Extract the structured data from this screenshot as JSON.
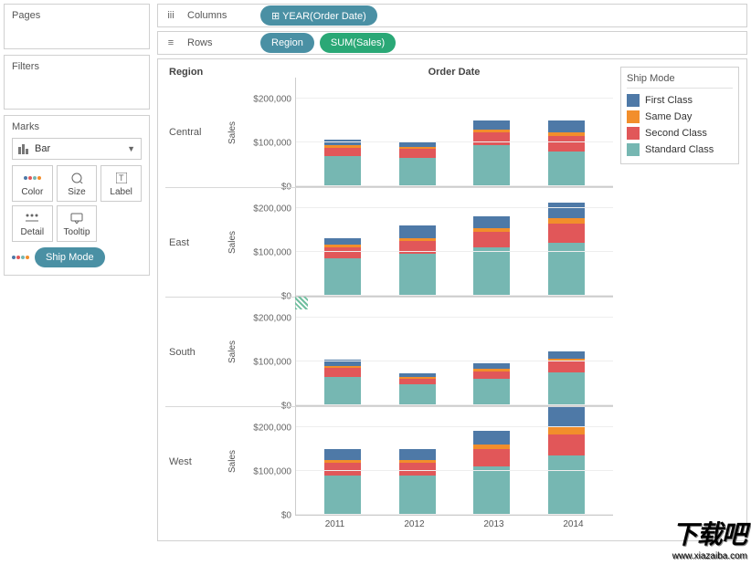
{
  "left": {
    "pages_title": "Pages",
    "filters_title": "Filters",
    "marks_title": "Marks",
    "mark_type": "Bar",
    "buttons": {
      "color": "Color",
      "size": "Size",
      "label": "Label",
      "detail": "Detail",
      "tooltip": "Tooltip"
    },
    "color_pill": "Ship Mode"
  },
  "shelves": {
    "columns_label": "Columns",
    "rows_label": "Rows",
    "year_pill": "⊞ YEAR(Order Date)",
    "region_pill": "Region",
    "sum_pill": "SUM(Sales)"
  },
  "chart": {
    "region_header": "Region",
    "orderdate_header": "Order Date",
    "y_label": "Sales",
    "y_ticks": [
      "$0",
      "$100,000",
      "$200,000"
    ],
    "x_ticks": [
      "2011",
      "2012",
      "2013",
      "2014"
    ],
    "facets": [
      "Central",
      "East",
      "South",
      "West"
    ]
  },
  "legend": {
    "title": "Ship Mode",
    "items": [
      "First Class",
      "Same Day",
      "Second Class",
      "Standard Class"
    ]
  },
  "colors": {
    "first_class": "#4e79a7",
    "same_day": "#f28e2b",
    "second_class": "#e15759",
    "standard_class": "#76b7b2"
  },
  "watermark": {
    "big": "下载吧",
    "small": "www.xiazaiba.com"
  },
  "chart_data": {
    "type": "bar",
    "stacked": true,
    "x": [
      2011,
      2012,
      2013,
      2014
    ],
    "ylabel": "Sales",
    "ylim": [
      0,
      250000
    ],
    "y_ticks": [
      0,
      100000,
      200000
    ],
    "facet_by": "Region",
    "stack_by": "Ship Mode",
    "legend": [
      "First Class",
      "Same Day",
      "Second Class",
      "Standard Class"
    ],
    "colors": {
      "First Class": "#4e79a7",
      "Same Day": "#f28e2b",
      "Second Class": "#e15759",
      "Standard Class": "#76b7b2"
    },
    "facets": [
      {
        "region": "Central",
        "series": {
          "Standard Class": [
            68000,
            65000,
            93000,
            80000
          ],
          "Second Class": [
            20000,
            20000,
            30000,
            35000
          ],
          "Same Day": [
            5000,
            5000,
            7000,
            8000
          ],
          "First Class": [
            14000,
            13000,
            20000,
            27000
          ]
        },
        "totals": [
          107000,
          103000,
          150000,
          150000
        ]
      },
      {
        "region": "East",
        "series": {
          "Standard Class": [
            85000,
            95000,
            110000,
            120000
          ],
          "Second Class": [
            25000,
            30000,
            35000,
            45000
          ],
          "Same Day": [
            6000,
            7000,
            9000,
            12000
          ],
          "First Class": [
            16000,
            28000,
            28000,
            35000
          ]
        },
        "totals": [
          132000,
          160000,
          182000,
          212000
        ]
      },
      {
        "region": "South",
        "series": {
          "Standard Class": [
            65000,
            48000,
            60000,
            75000
          ],
          "Second Class": [
            20000,
            13000,
            18000,
            25000
          ],
          "Same Day": [
            4000,
            3000,
            5000,
            6000
          ],
          "First Class": [
            15000,
            10000,
            12000,
            16000
          ]
        },
        "totals": [
          104000,
          74000,
          95000,
          122000
        ]
      },
      {
        "region": "West",
        "series": {
          "Standard Class": [
            90000,
            90000,
            110000,
            135000
          ],
          "Second Class": [
            28000,
            28000,
            40000,
            48000
          ],
          "Same Day": [
            7000,
            7000,
            10000,
            20000
          ],
          "First Class": [
            26000,
            25000,
            32000,
            43000
          ]
        },
        "totals": [
          151000,
          150000,
          192000,
          246000
        ]
      }
    ]
  }
}
